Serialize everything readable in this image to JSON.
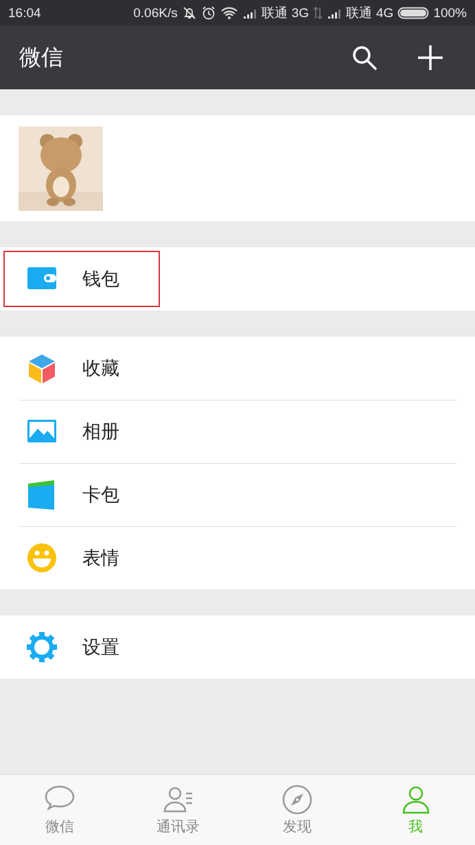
{
  "status_bar": {
    "time": "16:04",
    "speed": "0.06K/s",
    "carrier_1": "联通",
    "network_1": "3G",
    "carrier_2": "联通",
    "network_2": "4G",
    "battery": "100%"
  },
  "header": {
    "title": "微信"
  },
  "sections": [
    [
      {
        "kind": "wallet",
        "label": "钱包",
        "highlighted": true
      }
    ],
    [
      {
        "kind": "cube",
        "label": "收藏",
        "highlighted": false
      },
      {
        "kind": "album",
        "label": "相册",
        "highlighted": false
      },
      {
        "kind": "cards",
        "label": "卡包",
        "highlighted": false
      },
      {
        "kind": "smile",
        "label": "表情",
        "highlighted": false
      }
    ],
    [
      {
        "kind": "gear",
        "label": "设置",
        "highlighted": false
      }
    ]
  ],
  "tabs": [
    {
      "kind": "chat",
      "label": "微信",
      "selected": false
    },
    {
      "kind": "contacts",
      "label": "通讯录",
      "selected": false
    },
    {
      "kind": "compass",
      "label": "发现",
      "selected": false
    },
    {
      "kind": "person",
      "label": "我",
      "selected": true
    }
  ]
}
